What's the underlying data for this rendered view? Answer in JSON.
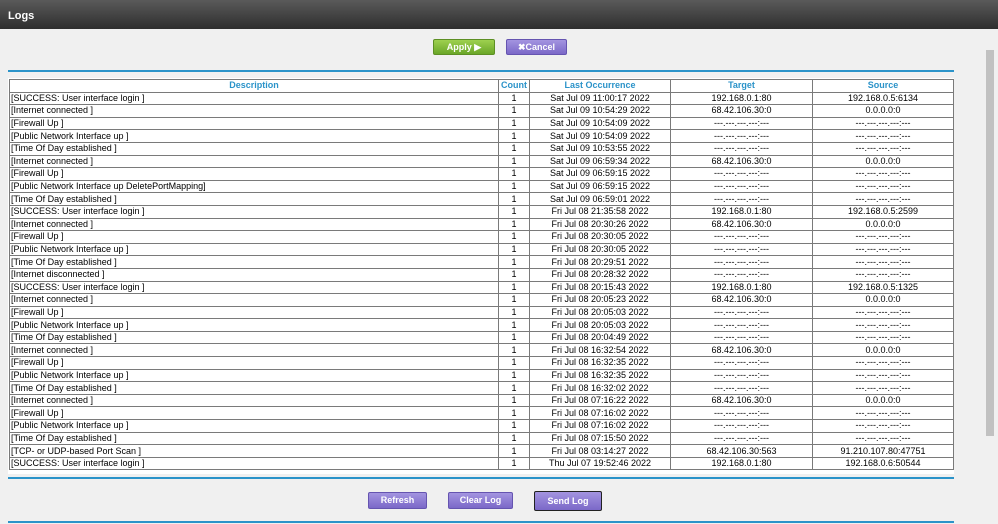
{
  "window": {
    "title": "Logs"
  },
  "toolbar": {
    "apply_label": "Apply ▶",
    "cancel_label": "✖Cancel"
  },
  "table": {
    "columns": [
      "Description",
      "Count",
      "Last Occurrence",
      "Target",
      "Source"
    ],
    "rows": [
      [
        "[SUCCESS: User interface login ]",
        "1",
        "Sat Jul 09 11:00:17 2022",
        "192.168.0.1:80",
        "192.168.0.5:6134"
      ],
      [
        "[Internet connected ]",
        "1",
        "Sat Jul 09 10:54:29 2022",
        "68.42.106.30:0",
        "0.0.0.0:0"
      ],
      [
        "[Firewall Up ]",
        "1",
        "Sat Jul 09 10:54:09 2022",
        "---.---.---.---:---",
        "---.---.---.---:---"
      ],
      [
        "[Public Network Interface up ]",
        "1",
        "Sat Jul 09 10:54:09 2022",
        "---.---.---.---:---",
        "---.---.---.---:---"
      ],
      [
        "[Time Of Day established ]",
        "1",
        "Sat Jul 09 10:53:55 2022",
        "---.---.---.---:---",
        "---.---.---.---:---"
      ],
      [
        "[Internet connected ]",
        "1",
        "Sat Jul 09 06:59:34 2022",
        "68.42.106.30:0",
        "0.0.0.0:0"
      ],
      [
        "[Firewall Up ]",
        "1",
        "Sat Jul 09 06:59:15 2022",
        "---.---.---.---:---",
        "---.---.---.---:---"
      ],
      [
        "[Public Network Interface up DeletePortMapping]",
        "1",
        "Sat Jul 09 06:59:15 2022",
        "---.---.---.---:---",
        "---.---.---.---:---"
      ],
      [
        "[Time Of Day established ]",
        "1",
        "Sat Jul 09 06:59:01 2022",
        "---.---.---.---:---",
        "---.---.---.---:---"
      ],
      [
        "[SUCCESS: User interface login ]",
        "1",
        "Fri Jul 08 21:35:58 2022",
        "192.168.0.1:80",
        "192.168.0.5:2599"
      ],
      [
        "[Internet connected ]",
        "1",
        "Fri Jul 08 20:30:26 2022",
        "68.42.106.30:0",
        "0.0.0.0:0"
      ],
      [
        "[Firewall Up ]",
        "1",
        "Fri Jul 08 20:30:05 2022",
        "---.---.---.---:---",
        "---.---.---.---:---"
      ],
      [
        "[Public Network Interface up ]",
        "1",
        "Fri Jul 08 20:30:05 2022",
        "---.---.---.---:---",
        "---.---.---.---:---"
      ],
      [
        "[Time Of Day established ]",
        "1",
        "Fri Jul 08 20:29:51 2022",
        "---.---.---.---:---",
        "---.---.---.---:---"
      ],
      [
        "[Internet disconnected ]",
        "1",
        "Fri Jul 08 20:28:32 2022",
        "---.---.---.---:---",
        "---.---.---.---:---"
      ],
      [
        "[SUCCESS: User interface login ]",
        "1",
        "Fri Jul 08 20:15:43 2022",
        "192.168.0.1:80",
        "192.168.0.5:1325"
      ],
      [
        "[Internet connected ]",
        "1",
        "Fri Jul 08 20:05:23 2022",
        "68.42.106.30:0",
        "0.0.0.0:0"
      ],
      [
        "[Firewall Up ]",
        "1",
        "Fri Jul 08 20:05:03 2022",
        "---.---.---.---:---",
        "---.---.---.---:---"
      ],
      [
        "[Public Network Interface up ]",
        "1",
        "Fri Jul 08 20:05:03 2022",
        "---.---.---.---:---",
        "---.---.---.---:---"
      ],
      [
        "[Time Of Day established ]",
        "1",
        "Fri Jul 08 20:04:49 2022",
        "---.---.---.---:---",
        "---.---.---.---:---"
      ],
      [
        "[Internet connected ]",
        "1",
        "Fri Jul 08 16:32:54 2022",
        "68.42.106.30:0",
        "0.0.0.0:0"
      ],
      [
        "[Firewall Up ]",
        "1",
        "Fri Jul 08 16:32:35 2022",
        "---.---.---.---:---",
        "---.---.---.---:---"
      ],
      [
        "[Public Network Interface up ]",
        "1",
        "Fri Jul 08 16:32:35 2022",
        "---.---.---.---:---",
        "---.---.---.---:---"
      ],
      [
        "[Time Of Day established ]",
        "1",
        "Fri Jul 08 16:32:02 2022",
        "---.---.---.---:---",
        "---.---.---.---:---"
      ],
      [
        "[Internet connected ]",
        "1",
        "Fri Jul 08 07:16:22 2022",
        "68.42.106.30:0",
        "0.0.0.0:0"
      ],
      [
        "[Firewall Up ]",
        "1",
        "Fri Jul 08 07:16:02 2022",
        "---.---.---.---:---",
        "---.---.---.---:---"
      ],
      [
        "[Public Network Interface up ]",
        "1",
        "Fri Jul 08 07:16:02 2022",
        "---.---.---.---:---",
        "---.---.---.---:---"
      ],
      [
        "[Time Of Day established ]",
        "1",
        "Fri Jul 08 07:15:50 2022",
        "---.---.---.---:---",
        "---.---.---.---:---"
      ],
      [
        "[TCP- or UDP-based Port Scan ]",
        "1",
        "Fri Jul 08 03:14:27 2022",
        "68.42.106.30:563",
        "91.210.107.80:47751"
      ],
      [
        "[SUCCESS: User interface login ]",
        "1",
        "Thu Jul 07 19:52:46 2022",
        "192.168.0.1:80",
        "192.168.0.6:50544"
      ]
    ]
  },
  "footer": {
    "refresh_label": "Refresh",
    "clear_label": "Clear Log",
    "send_label": "Send Log"
  },
  "colors": {
    "accent": "#2b93c9",
    "apply_green": "#7dbb35",
    "button_purple": "#8a78d4",
    "titlebar": "#3a3a3a"
  }
}
